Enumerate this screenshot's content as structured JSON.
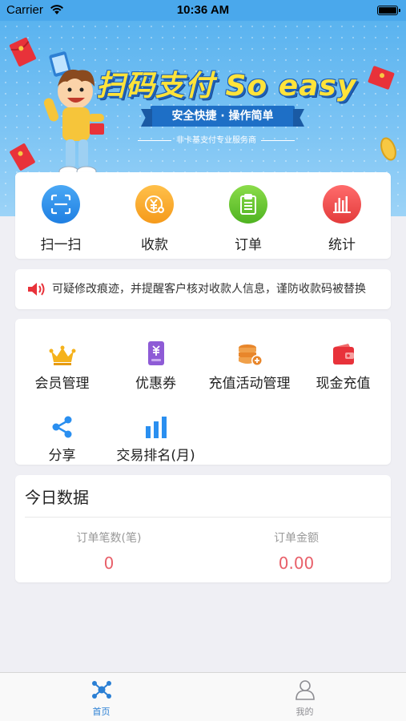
{
  "status_bar": {
    "carrier": "Carrier",
    "time": "10:36 AM"
  },
  "banner": {
    "headline": "扫码支付 So easy",
    "ribbon": "安全快捷 · 操作简单",
    "subtitle": "非卡基支付专业服务商"
  },
  "quick_actions": [
    {
      "label": "扫一扫",
      "icon": "scan-icon",
      "color": "#2a8ff0"
    },
    {
      "label": "收款",
      "icon": "yuan-coin-icon",
      "color": "#f5a623"
    },
    {
      "label": "订单",
      "icon": "clipboard-icon",
      "color": "#66c22b"
    },
    {
      "label": "统计",
      "icon": "bar-stats-icon",
      "color": "#f04747"
    }
  ],
  "notice": {
    "text": "可疑修改痕迹，并提醒客户核对收款人信息，谨防收款码被替换"
  },
  "features": [
    {
      "label": "会员管理",
      "icon": "crown-icon"
    },
    {
      "label": "优惠券",
      "icon": "coupon-icon"
    },
    {
      "label": "充值活动管理",
      "icon": "coin-stack-add-icon"
    },
    {
      "label": "现金充值",
      "icon": "wallet-icon"
    },
    {
      "label": "分享",
      "icon": "share-icon"
    },
    {
      "label": "交易排名(月)",
      "icon": "ranking-bars-icon"
    }
  ],
  "today": {
    "title": "今日数据",
    "order_count_label": "订单笔数(笔)",
    "order_count_value": "0",
    "order_amount_label": "订单金额",
    "order_amount_value": "0.00"
  },
  "tabbar": {
    "home_label": "首页",
    "mine_label": "我的",
    "active_color": "#2a7fd4",
    "inactive_color": "#8e8e93"
  }
}
